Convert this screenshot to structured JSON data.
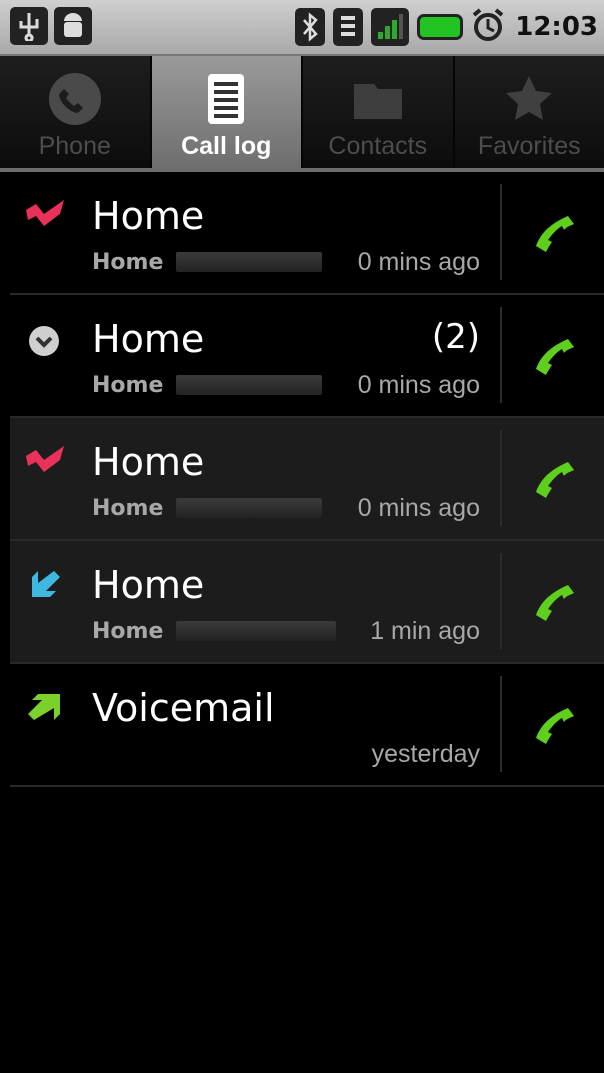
{
  "status_bar": {
    "time": "12:03",
    "left_icons": [
      "usb-icon",
      "android-debug-icon"
    ],
    "right_icons": [
      "bluetooth-icon",
      "wifi-icon",
      "signal-icon",
      "battery-icon",
      "alarm-icon"
    ]
  },
  "tabs": [
    {
      "label": "Phone",
      "icon": "phone-icon",
      "active": false
    },
    {
      "label": "Call log",
      "icon": "call-log-icon",
      "active": true
    },
    {
      "label": "Contacts",
      "icon": "contacts-icon",
      "active": false
    },
    {
      "label": "Favorites",
      "icon": "star-icon",
      "active": false
    }
  ],
  "call_log": [
    {
      "name": "Home",
      "type": "missed",
      "count": "",
      "label": "Home",
      "time": "0 mins ago"
    },
    {
      "name": "Home",
      "type": "group-expand",
      "count": "(2)",
      "label": "Home",
      "time": "0 mins ago"
    },
    {
      "name": "Home",
      "type": "missed",
      "count": "",
      "label": "Home",
      "time": "0 mins ago"
    },
    {
      "name": "Home",
      "type": "incoming",
      "count": "",
      "label": "Home",
      "time": "1 min ago"
    },
    {
      "name": "Voicemail",
      "type": "outgoing",
      "count": "",
      "label": "",
      "time": "yesterday"
    }
  ],
  "colors": {
    "missed": "#e8325a",
    "incoming": "#3fb8e0",
    "outgoing": "#7bd12c",
    "call_button": "#5fcf1e"
  }
}
